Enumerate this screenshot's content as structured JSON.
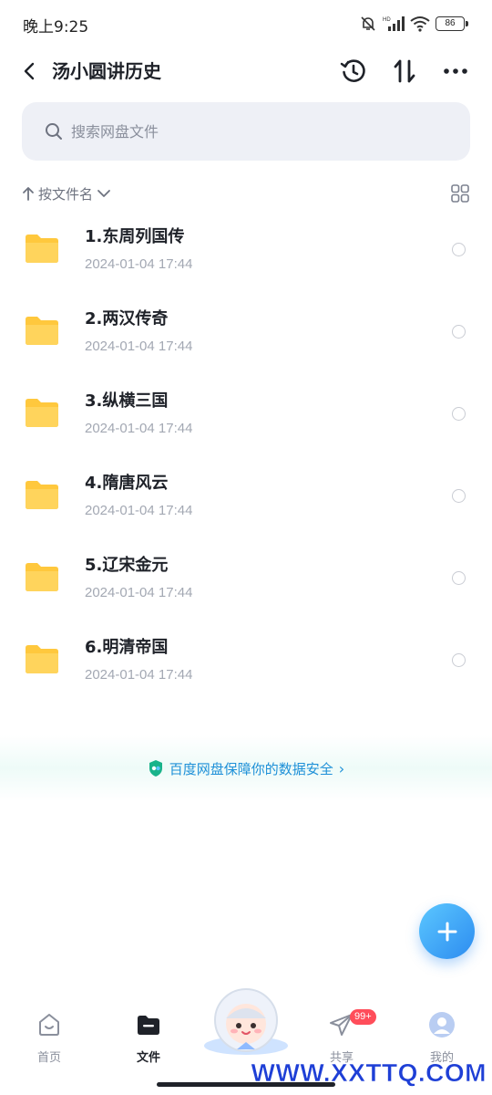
{
  "status_bar": {
    "time": "晚上9:25",
    "network_label": "HD",
    "battery": "86"
  },
  "header": {
    "title": "汤小圆讲历史"
  },
  "search": {
    "placeholder": "搜索网盘文件"
  },
  "sort": {
    "label": "按文件名"
  },
  "files": [
    {
      "name": "1.东周列国传",
      "date": "2024-01-04  17:44"
    },
    {
      "name": "2.两汉传奇",
      "date": "2024-01-04  17:44"
    },
    {
      "name": "3.纵横三国",
      "date": "2024-01-04  17:44"
    },
    {
      "name": "4.隋唐风云",
      "date": "2024-01-04  17:44"
    },
    {
      "name": "5.辽宋金元",
      "date": "2024-01-04  17:44"
    },
    {
      "name": "6.明清帝国",
      "date": "2024-01-04  17:44"
    }
  ],
  "banner": {
    "text": "百度网盘保障你的数据安全",
    "chevron": "›"
  },
  "tabs": [
    {
      "label": "首页",
      "icon": "home-icon",
      "active": false
    },
    {
      "label": "文件",
      "icon": "folder-icon",
      "active": true
    },
    {
      "label": "共享",
      "icon": "share-icon",
      "active": false,
      "badge": "99+"
    },
    {
      "label": "我的",
      "icon": "profile-icon",
      "active": false
    }
  ],
  "watermark": "WWW.XXTTQ.COM",
  "colors": {
    "accent": "#2d8cf0",
    "folder": "#ffc83d",
    "badge": "#ff4d5a",
    "banner_text": "#1e90d8"
  }
}
